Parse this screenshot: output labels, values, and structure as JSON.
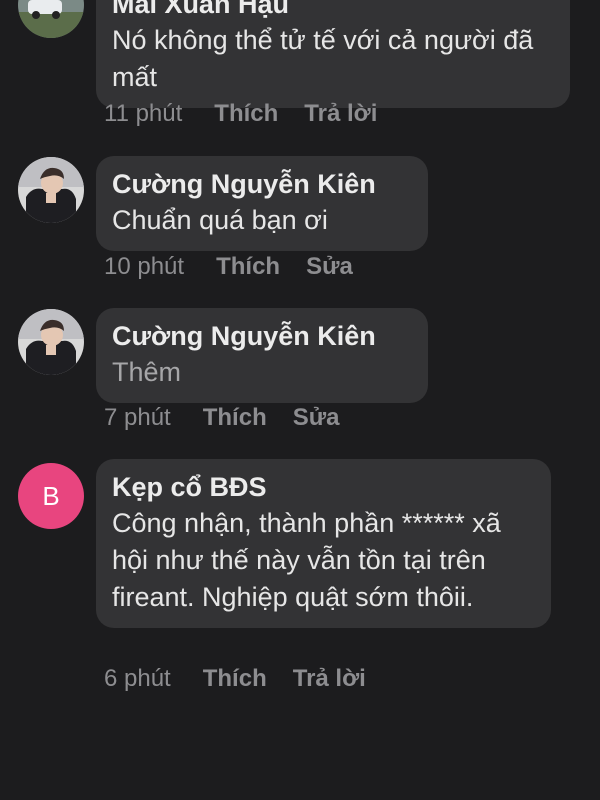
{
  "comments": [
    {
      "author": "Mai Xuân Hậu",
      "text": "Nó không thể tử tế với cả người đã mất",
      "time": "11 phút",
      "like": "Thích",
      "action2": "Trả lời",
      "avatar": "photo"
    },
    {
      "author": "Cường Nguyễn Kiên",
      "text": "Chuẩn quá bạn ơi",
      "time": "10 phút",
      "like": "Thích",
      "action2": "Sửa",
      "avatar": "photo"
    },
    {
      "author": "Cường Nguyễn Kiên",
      "text": "Thêm",
      "time": "7 phút",
      "like": "Thích",
      "action2": "Sửa",
      "avatar": "photo"
    },
    {
      "author": "Kẹp cổ BĐS",
      "text": "Công nhận, thành phần ****** xã hội như thế này vẫn tồn tại trên fireant. Nghiệp quật sớm thôii.",
      "time": "6 phút",
      "like": "Thích",
      "action2": "Trả lời",
      "avatar_letter": "B"
    }
  ],
  "colors": {
    "background": "#1c1c1e",
    "bubble": "#333335",
    "meta_text": "#8d8d90",
    "letter_avatar": "#e8457f"
  }
}
